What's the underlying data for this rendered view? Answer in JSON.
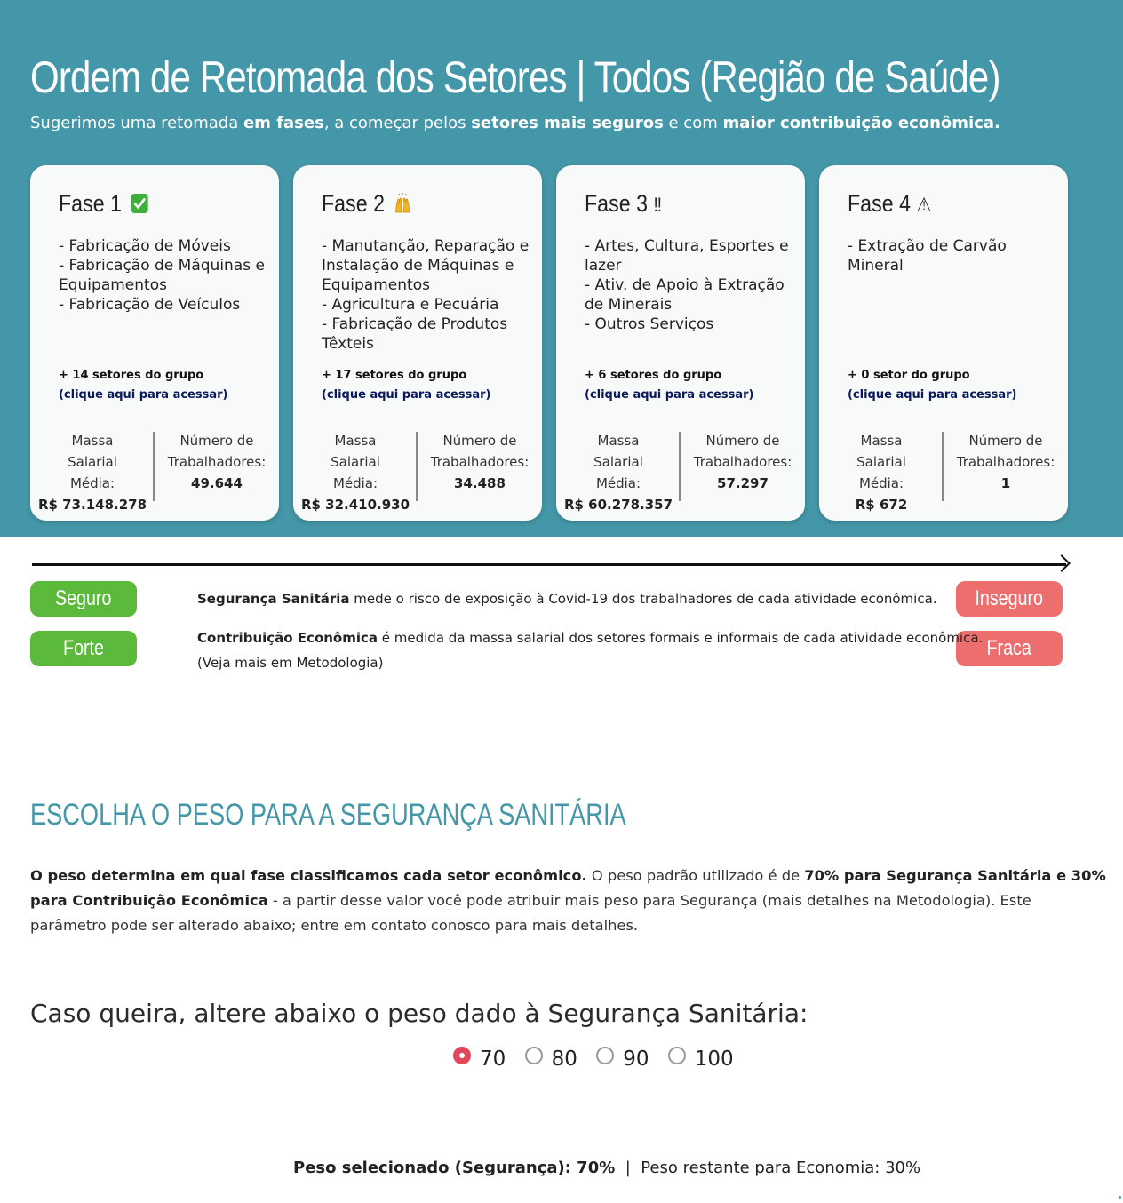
{
  "colors": {
    "primary": "#4497a8",
    "safe": "#5bba3c",
    "unsafe": "#ec6f6e",
    "selected_radio": "#e0475a"
  },
  "header": {
    "title": "Ordem de Retomada dos Setores | Todos (Região de Saúde)",
    "subtitle": {
      "p1": "Sugerimos uma retomada ",
      "b1": "em fases",
      "p2": ", a começar pelos ",
      "b2": "setores mais seguros",
      "p3": " e com ",
      "b3": "maior contribuição econômica."
    }
  },
  "phases": [
    {
      "title": "Fase 1",
      "icon": "check-mark-icon",
      "sectors": [
        "- Fabricação de Móveis",
        "- Fabricação de Máquinas e Equipamentos",
        "- Fabricação de Veículos"
      ],
      "more": "+ 14 setores do grupo",
      "link": "(clique aqui para acessar)",
      "wage_label": "Massa Salarial Média:",
      "wage_value": "R$ 73.148.278",
      "workers_label": "Número de Trabalhadores:",
      "workers_value": "49.644"
    },
    {
      "title": "Fase 2",
      "icon": "raising-hands-icon",
      "sectors": [
        "- Manutanção, Reparação e Instalação de Máquinas e Equipamentos",
        "- Agricultura e Pecuária",
        "- Fabricação de Produtos Têxteis"
      ],
      "more": "+ 17 setores do grupo",
      "link": "(clique aqui para acessar)",
      "wage_label": "Massa Salarial Média:",
      "wage_value": "R$ 32.410.930",
      "workers_label": "Número de Trabalhadores:",
      "workers_value": "34.488"
    },
    {
      "title": "Fase 3",
      "icon": "double-exclamation-icon",
      "icon_glyph": "‼",
      "sectors": [
        "- Artes, Cultura, Esportes e lazer",
        "- Ativ. de Apoio à Extração de Minerais",
        "- Outros Serviços"
      ],
      "more": "+ 6 setores do grupo",
      "link": "(clique aqui para acessar)",
      "wage_label": "Massa Salarial Média:",
      "wage_value": "R$ 60.278.357",
      "workers_label": "Número de Trabalhadores:",
      "workers_value": "57.297"
    },
    {
      "title": "Fase 4",
      "icon": "warning-icon",
      "icon_glyph": "⚠",
      "sectors": [
        "- Extração de Carvão Mineral"
      ],
      "more": "+ 0 setor do grupo",
      "link": "(clique aqui para acessar)",
      "wage_label": "Massa Salarial Média:",
      "wage_value": "R$ 672",
      "workers_label": "Número de Trabalhadores:",
      "workers_value": "1"
    }
  ],
  "legend": {
    "safe_label": "Seguro",
    "unsafe_label": "Inseguro",
    "strong_label": "Forte",
    "weak_label": "Fraca",
    "safety_bold": "Segurança Sanitária",
    "safety_text": " mede o risco de exposição à Covid-19 dos trabalhadores de cada atividade econômica.",
    "economy_bold": "Contribuição Econômica",
    "economy_text": " é medida da massa salarial dos setores formais e informais de cada atividade econômica.",
    "methodology_note": "(Veja mais em Metodologia)"
  },
  "weights": {
    "section_title": "ESCOLHA O PESO PARA A SEGURANÇA SANITÁRIA",
    "para_b1": "O peso determina em qual fase classificamos cada setor econômico.",
    "para_t1": " O peso padrão utilizado é de ",
    "para_b2": "70% para Segurança Sanitária e 30% para Contribuição Econômica",
    "para_t2": " - a partir desse valor você pode atribuir mais peso para Segurança (mais detalhes na Metodologia). Este parâmetro pode ser alterado abaixo; entre em contato conosco para mais detalhes.",
    "question": "Caso queira, altere abaixo o peso dado à Segurança Sanitária:",
    "options": [
      "70",
      "80",
      "90",
      "100"
    ],
    "selected": "70",
    "summary_bold": "Peso selecionado (Segurança): 70%",
    "summary_sep": "  |  ",
    "summary_rest": "Peso restante para Economia: 30%"
  }
}
